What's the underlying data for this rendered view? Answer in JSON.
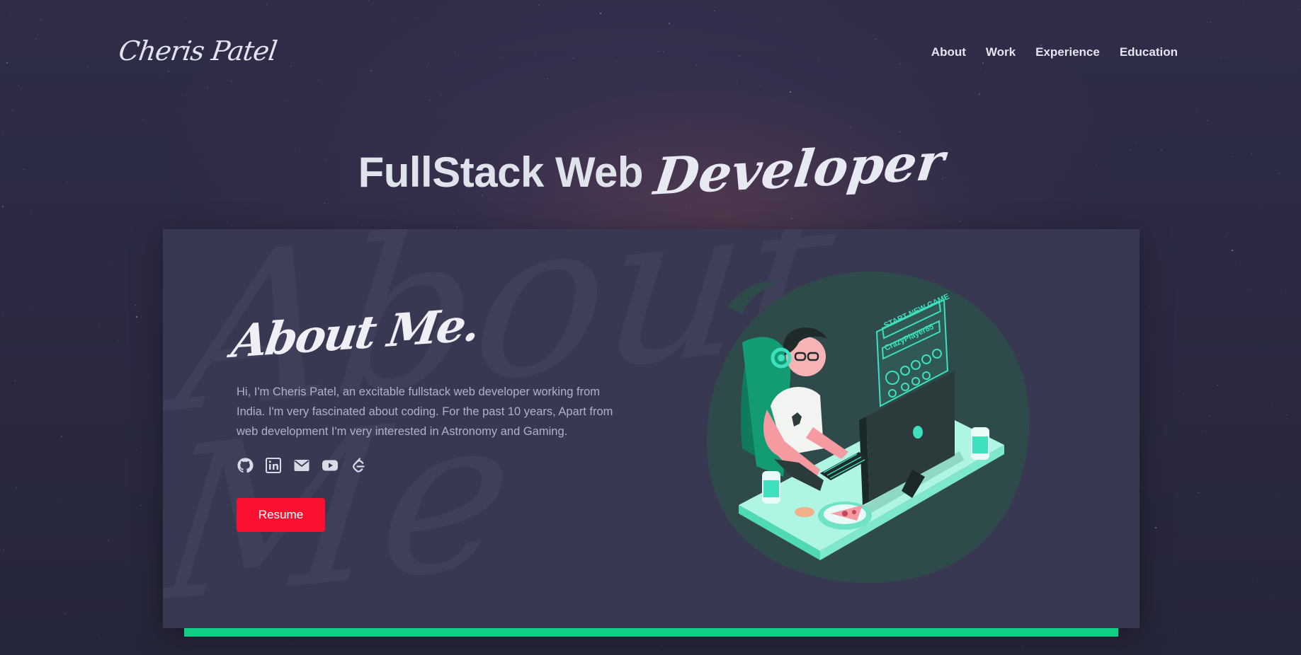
{
  "header": {
    "logo": "Cheris Patel",
    "nav": [
      "About",
      "Work",
      "Experience",
      "Education"
    ]
  },
  "hero": {
    "title_plain": "FullStack Web",
    "title_script": "Developer"
  },
  "about": {
    "watermark": "About\nMe",
    "heading": "About Me.",
    "text": "Hi, I'm Cheris Patel, an excitable fullstack web developer working from India. I'm very fascinated about coding. For the past 10 years, Apart from web development I'm very interested in Astronomy and Gaming.",
    "socials": [
      "github-icon",
      "linkedin-icon",
      "email-icon",
      "youtube-icon",
      "leetcode-icon"
    ],
    "resume_label": "Resume"
  },
  "illustration": {
    "screen_title": "START NEW GAME",
    "player_name": "CrazyPlayer85"
  },
  "colors": {
    "background": "#2b2a40",
    "card": "#393853",
    "accent_red": "#fc1030",
    "accent_green": "#10cf85",
    "illustration_teal": "#3ee0bd"
  }
}
